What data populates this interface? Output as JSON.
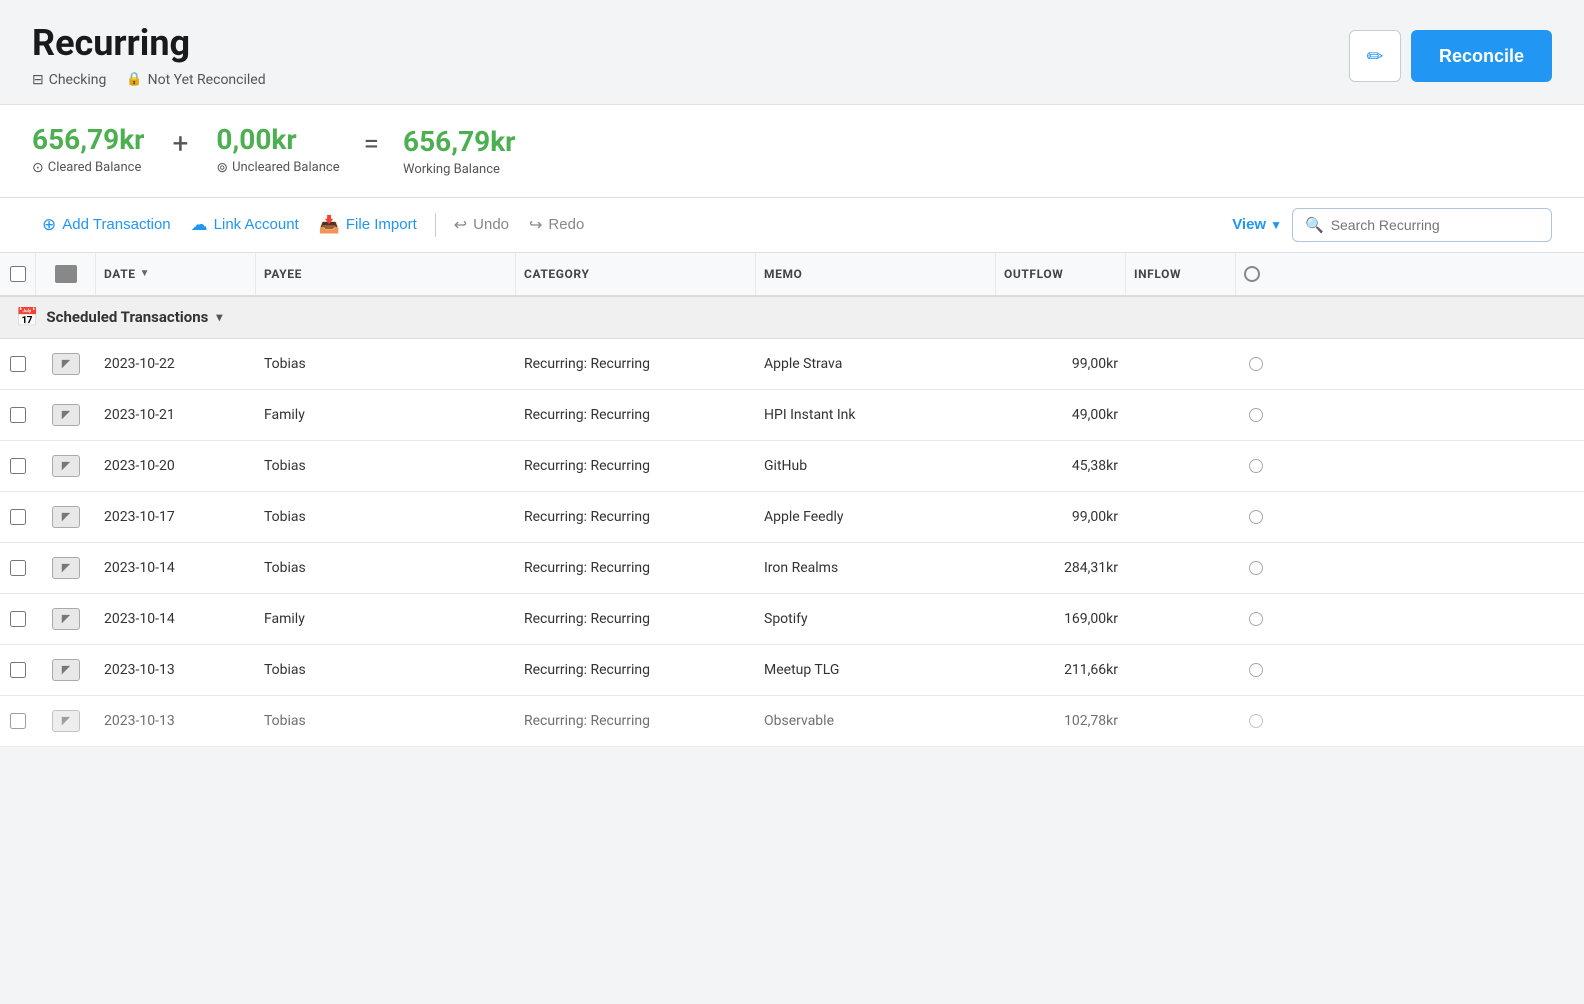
{
  "header": {
    "title": "Recurring",
    "meta": {
      "account_type": "Checking",
      "reconcile_status": "Not Yet Reconciled"
    },
    "edit_button_label": "✏",
    "reconcile_button_label": "Reconcile"
  },
  "balance": {
    "cleared_amount": "656,79kr",
    "cleared_label": "Cleared Balance",
    "uncleared_amount": "0,00kr",
    "uncleared_label": "Uncleared Balance",
    "working_amount": "656,79kr",
    "working_label": "Working Balance"
  },
  "toolbar": {
    "add_transaction_label": "Add Transaction",
    "link_account_label": "Link Account",
    "file_import_label": "File Import",
    "undo_label": "Undo",
    "redo_label": "Redo",
    "view_label": "View",
    "search_placeholder": "Search Recurring"
  },
  "table": {
    "columns": [
      {
        "key": "check",
        "label": ""
      },
      {
        "key": "flag",
        "label": ""
      },
      {
        "key": "date",
        "label": "DATE"
      },
      {
        "key": "payee",
        "label": "PAYEE"
      },
      {
        "key": "category",
        "label": "CATEGORY"
      },
      {
        "key": "memo",
        "label": "MEMO"
      },
      {
        "key": "outflow",
        "label": "OUTFLOW"
      },
      {
        "key": "inflow",
        "label": "INFLOW"
      },
      {
        "key": "cleared",
        "label": "C"
      }
    ],
    "group_label": "Scheduled Transactions",
    "transactions": [
      {
        "date": "2023-10-22",
        "payee": "Tobias",
        "category": "Recurring: Recurring",
        "memo": "Apple Strava",
        "outflow": "99,00kr",
        "inflow": ""
      },
      {
        "date": "2023-10-21",
        "payee": "Family",
        "category": "Recurring: Recurring",
        "memo": "HPI Instant Ink",
        "outflow": "49,00kr",
        "inflow": ""
      },
      {
        "date": "2023-10-20",
        "payee": "Tobias",
        "category": "Recurring: Recurring",
        "memo": "GitHub",
        "outflow": "45,38kr",
        "inflow": ""
      },
      {
        "date": "2023-10-17",
        "payee": "Tobias",
        "category": "Recurring: Recurring",
        "memo": "Apple Feedly",
        "outflow": "99,00kr",
        "inflow": ""
      },
      {
        "date": "2023-10-14",
        "payee": "Tobias",
        "category": "Recurring: Recurring",
        "memo": "Iron Realms",
        "outflow": "284,31kr",
        "inflow": ""
      },
      {
        "date": "2023-10-14",
        "payee": "Family",
        "category": "Recurring: Recurring",
        "memo": "Spotify",
        "outflow": "169,00kr",
        "inflow": ""
      },
      {
        "date": "2023-10-13",
        "payee": "Tobias",
        "category": "Recurring: Recurring",
        "memo": "Meetup TLG",
        "outflow": "211,66kr",
        "inflow": ""
      },
      {
        "date": "2023-10-13",
        "payee": "Tobias",
        "category": "Recurring: Recurring",
        "memo": "Observable",
        "outflow": "102,78kr",
        "inflow": ""
      }
    ]
  }
}
